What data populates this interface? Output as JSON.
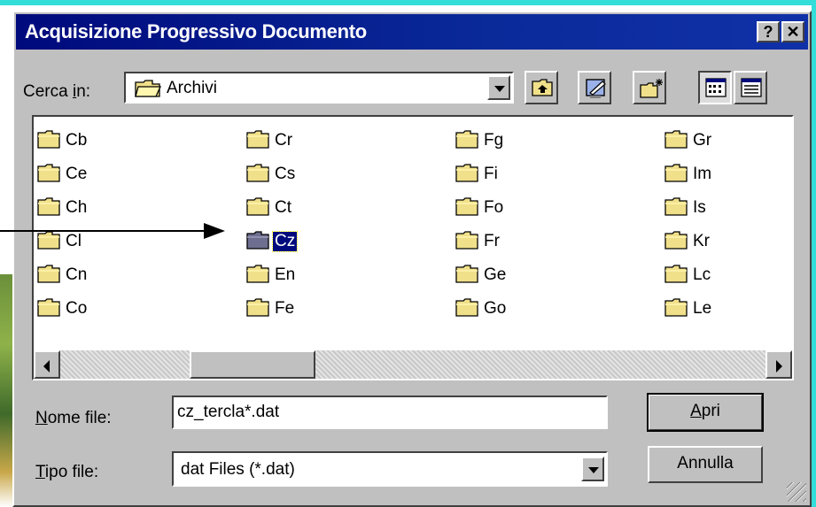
{
  "window": {
    "title": "Acquisizione Progressivo Documento",
    "help_label": "?",
    "close_label": "✕"
  },
  "lookin": {
    "label_pre": "Cerca ",
    "label_key": "i",
    "label_post": "n:",
    "value": "Archivi",
    "icon": "open-folder-icon"
  },
  "toolbar": {
    "buttons": [
      {
        "name": "up-one-level",
        "icon": "folder-up-icon"
      },
      {
        "name": "desktop",
        "icon": "desktop-icon"
      },
      {
        "name": "new-folder",
        "icon": "new-folder-icon"
      },
      {
        "name": "list-view",
        "icon": "list-view-icon",
        "pressed": true
      },
      {
        "name": "details-view",
        "icon": "details-view-icon",
        "pressed": false
      }
    ]
  },
  "files": {
    "columns": [
      [
        "Cb",
        "Ce",
        "Ch",
        "Cl",
        "Cn",
        "Co"
      ],
      [
        "Cr",
        "Cs",
        "Ct",
        "Cz",
        "En",
        "Fe"
      ],
      [
        "Fg",
        "Fi",
        "Fo",
        "Fr",
        "Ge",
        "Go"
      ],
      [
        "Gr",
        "Im",
        "Is",
        "Kr",
        "Lc",
        "Le"
      ]
    ],
    "selected": "Cz"
  },
  "filename": {
    "label_key": "N",
    "label_rest": "ome file:",
    "value": "cz_tercla*.dat"
  },
  "filetype": {
    "label_key": "T",
    "label_rest": "ipo file:",
    "value": "dat Files (*.dat)"
  },
  "buttons": {
    "open_key": "A",
    "open_rest": "pri",
    "cancel": "Annulla"
  },
  "colors": {
    "title_bar": "#000a7c",
    "frame": "#33ddd8",
    "dialog_face": "#c0c0c0",
    "selection": "#000a7c",
    "folder": "#f0e08a"
  }
}
